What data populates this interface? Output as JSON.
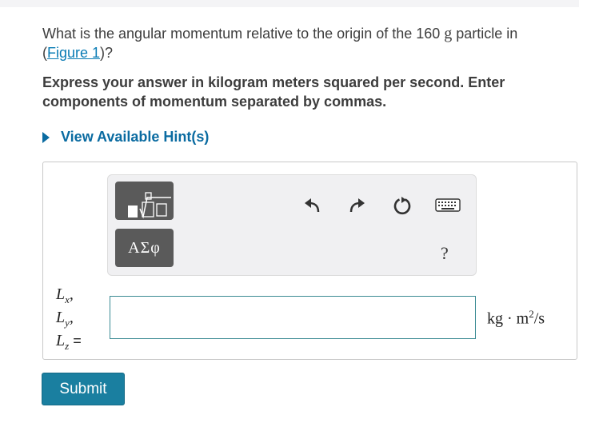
{
  "question": {
    "text_before": "What is the angular momentum relative to the origin of the 160 ",
    "mass_unit": "g",
    "text_after": " particle in",
    "link_open": "(",
    "link_label": "Figure 1",
    "link_close": ")?"
  },
  "instructions": "Express your answer in kilogram meters squared per second. Enter components of momentum separated by commas.",
  "hint_label": "View Available Hint(s)",
  "toolbar": {
    "templates_icon": "fraction-root-template-icon",
    "symbols_label": "ΑΣφ",
    "undo_icon": "undo-icon",
    "redo_icon": "redo-icon",
    "reset_icon": "reset-icon",
    "keyboard_icon": "keyboard-icon",
    "help_label": "?"
  },
  "answer": {
    "lx_var": "L",
    "lx_sub": "x",
    "lx_sep": ",",
    "ly_var": "L",
    "ly_sub": "y",
    "ly_sep": ",",
    "lz_var": "L",
    "lz_sub": "z",
    "lz_eq": " =",
    "value": "",
    "units_main": "kg · m",
    "units_sup": "2",
    "units_tail": "/s"
  },
  "submit_label": "Submit",
  "colors": {
    "accent": "#0a6ba1",
    "submit": "#1a7fa0",
    "input_border": "#3a8a93"
  }
}
